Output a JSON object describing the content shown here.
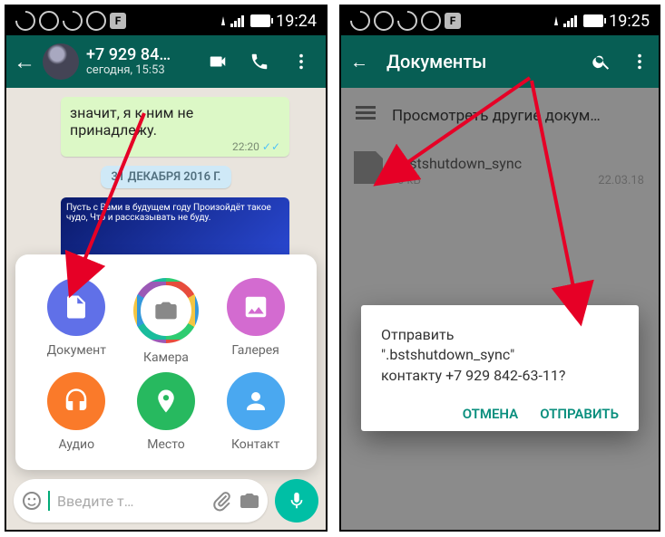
{
  "statusbar": {
    "time_left": "19:24",
    "time_right": "19:25"
  },
  "chat_header": {
    "title": "+7 929 84…",
    "subtitle": "сегодня, 15:53"
  },
  "chat": {
    "message_text": "значит, я к ним не принадлежу.",
    "message_time": "22:20",
    "date_chip": "31 ДЕКАБРЯ 2016 Г.",
    "card_text": "Пусть с Вами в будущем году Произойдёт такое чудо, Что и рассказывать не буду."
  },
  "attach": {
    "doc": "Документ",
    "cam": "Камера",
    "gal": "Галерея",
    "aud": "Аудио",
    "loc": "Место",
    "con": "Контакт"
  },
  "input": {
    "placeholder": "Введите т…"
  },
  "docs_header": {
    "title": "Документы"
  },
  "browse_row": {
    "label": "Просмотреть другие докум…"
  },
  "file": {
    "name": ".bstshutdown_sync",
    "size": "0 кБ",
    "date": "22.03.18"
  },
  "dialog": {
    "line1": "Отправить",
    "line2": "\".bstshutdown_sync\"",
    "line3": "контакту +7 929 842-63-11?",
    "cancel": "ОТМЕНА",
    "send": "ОТПРАВИТЬ"
  }
}
